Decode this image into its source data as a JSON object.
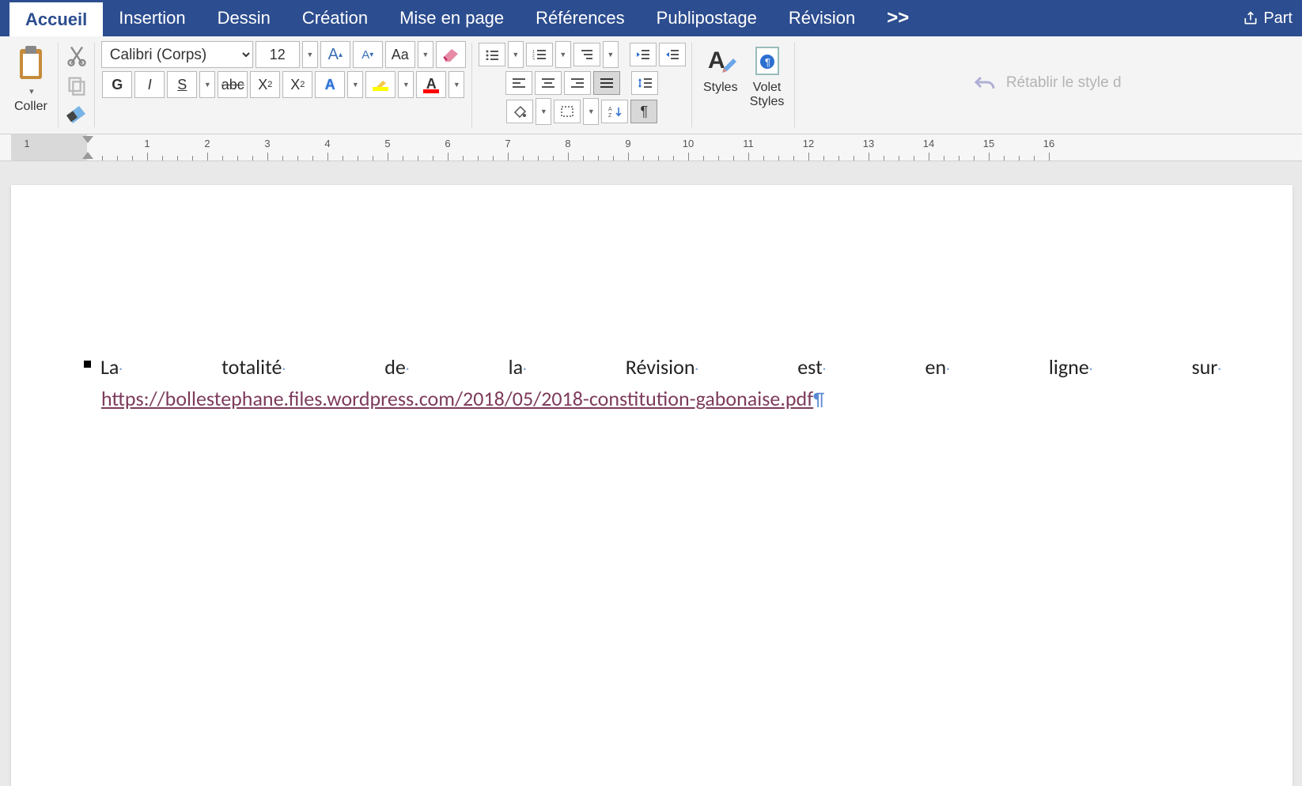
{
  "ribbon": {
    "tabs": [
      "Accueil",
      "Insertion",
      "Dessin",
      "Création",
      "Mise en page",
      "Références",
      "Publipostage",
      "Révision"
    ],
    "active_tab": "Accueil",
    "overflow": ">>",
    "share": "Part"
  },
  "clipboard": {
    "paste": "Coller"
  },
  "font": {
    "name": "Calibri (Corps)",
    "size": "12",
    "grow": "A▴",
    "shrink": "A▾",
    "change_case": "Aa",
    "clear": "A",
    "bold": "G",
    "italic": "I",
    "underline": "S",
    "strike": "abc",
    "sub": "X",
    "sup": "X",
    "texteffect": "A",
    "fontcolor": "A"
  },
  "styles": {
    "styles": "Styles",
    "pane_l1": "Volet",
    "pane_l2": "Styles"
  },
  "restore": "Rétablir le style d",
  "ruler": {
    "numbers": [
      1,
      1,
      2,
      3,
      4,
      5,
      6,
      7,
      8,
      9,
      10,
      11,
      12,
      13,
      14,
      15,
      16
    ]
  },
  "document": {
    "words": [
      "La",
      "totalité",
      "de",
      "la",
      "Révision",
      "est",
      "en",
      "ligne",
      "sur"
    ],
    "url": "https://bollestephane.files.wordpress.com/2018/05/2018-constitution-gabonaise.pdf"
  }
}
